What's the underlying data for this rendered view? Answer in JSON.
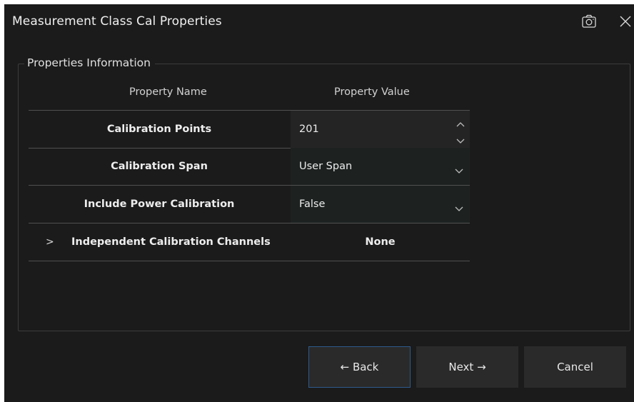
{
  "window": {
    "title": "Measurement Class Cal Properties"
  },
  "group": {
    "title": "Properties Information",
    "col_name": "Property Name",
    "col_value": "Property Value"
  },
  "rows": [
    {
      "name": "Calibration Points",
      "value": "201",
      "control": "spinbox"
    },
    {
      "name": "Calibration Span",
      "value": "User Span",
      "control": "dropdown"
    },
    {
      "name": "Include Power Calibration",
      "value": "False",
      "control": "dropdown"
    },
    {
      "name": "Independent Calibration Channels",
      "value": "None",
      "control": "expandable",
      "expander": ">"
    }
  ],
  "buttons": {
    "back": "← Back",
    "next": "Next →",
    "cancel": "Cancel"
  },
  "icons": {
    "camera": "camera-icon",
    "close": "close-icon",
    "spin_up": "chevron-up-icon",
    "spin_down": "chevron-down-icon",
    "dropdown": "chevron-down-icon"
  },
  "colors": {
    "background": "#1b1b1b",
    "back_button_border": "#2d5a8c",
    "row_divider": "#505050"
  }
}
